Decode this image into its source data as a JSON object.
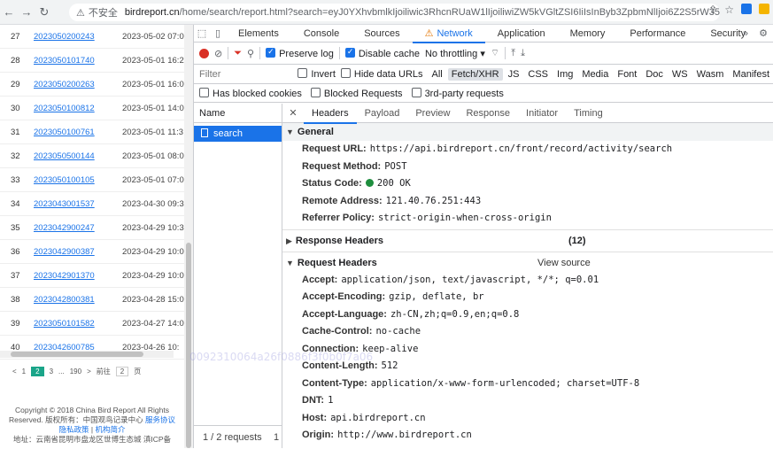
{
  "browser": {
    "security_label": "不安全",
    "url_host": "birdreport.cn",
    "url_path": "/home/search/report.html?search=eyJ0YXhvbmlkIjoiliwic3RhcnRUaW1lIjoiliwiZW5kVGltZSI6IiIsInByb3ZpbmNlIjoi6Z2S5rW355yBIiwiY2l0eSI6IiIsImRpc..."
  },
  "report_list": {
    "rows": [
      {
        "idx": "27",
        "id": "2023050200243",
        "date": "2023-05-02 07:0"
      },
      {
        "idx": "28",
        "id": "2023050101740",
        "date": "2023-05-01 16:2"
      },
      {
        "idx": "29",
        "id": "2023050200263",
        "date": "2023-05-01 16:0"
      },
      {
        "idx": "30",
        "id": "2023050100812",
        "date": "2023-05-01 14:0"
      },
      {
        "idx": "31",
        "id": "2023050100761",
        "date": "2023-05-01 11:3"
      },
      {
        "idx": "32",
        "id": "2023050500144",
        "date": "2023-05-01 08:0"
      },
      {
        "idx": "33",
        "id": "2023050100105",
        "date": "2023-05-01 07:0"
      },
      {
        "idx": "34",
        "id": "2023043001537",
        "date": "2023-04-30 09:3"
      },
      {
        "idx": "35",
        "id": "2023042900247",
        "date": "2023-04-29 10:3"
      },
      {
        "idx": "36",
        "id": "2023042900387",
        "date": "2023-04-29 10:0"
      },
      {
        "idx": "37",
        "id": "2023042901370",
        "date": "2023-04-29 10:0"
      },
      {
        "idx": "38",
        "id": "2023042800381",
        "date": "2023-04-28 15:0"
      },
      {
        "idx": "39",
        "id": "2023050101582",
        "date": "2023-04-27 14:0"
      },
      {
        "idx": "40",
        "id": "2023042600785",
        "date": "2023-04-26 10:"
      }
    ],
    "pager": {
      "prev": "<",
      "p1": "1",
      "p2": "2",
      "p3": "3",
      "ellipsis": "...",
      "last": "190",
      "next": ">",
      "goto": "前往",
      "input": "2",
      "page_unit": "页"
    },
    "footer": {
      "line1": "Copyright © 2018 China Bird Report All Rights",
      "line2": "Reserved. 版权所有：中国观鸟记录中心",
      "line2_link": "服务协议",
      "line3_link1": "隐私政策",
      "line3_link2": "机构简介",
      "line4": "地址：云南省昆明市盘龙区世博生态城",
      "line4_tail": "滇ICP备"
    }
  },
  "devtools": {
    "tabs": [
      "Elements",
      "Console",
      "Sources",
      "Network",
      "Application",
      "Memory",
      "Performance",
      "Security"
    ],
    "active_tab": "Network",
    "toolbar": {
      "preserve_log": "Preserve log",
      "disable_cache": "Disable cache",
      "throttling": "No throttling"
    },
    "filter": {
      "placeholder": "Filter",
      "invert": "Invert",
      "hide_data_urls": "Hide data URLs",
      "types": [
        "All",
        "Fetch/XHR",
        "JS",
        "CSS",
        "Img",
        "Media",
        "Font",
        "Doc",
        "WS",
        "Wasm",
        "Manifest"
      ]
    },
    "blockbar": {
      "blocked_cookies": "Has blocked cookies",
      "blocked_requests": "Blocked Requests",
      "third_party": "3rd-party requests"
    },
    "name_column": {
      "header": "Name",
      "request_name": "search",
      "status": "1 / 2 requests",
      "status_tail": "1"
    },
    "detail_tabs": [
      "Headers",
      "Payload",
      "Preview",
      "Response",
      "Initiator",
      "Timing"
    ],
    "general": {
      "title": "General",
      "request_url_k": "Request URL:",
      "request_url_v": "https://api.birdreport.cn/front/record/activity/search",
      "method_k": "Request Method:",
      "method_v": "POST",
      "status_k": "Status Code:",
      "status_v": "200 OK",
      "remote_k": "Remote Address:",
      "remote_v": "121.40.76.251:443",
      "referrer_k": "Referrer Policy:",
      "referrer_v": "strict-origin-when-cross-origin"
    },
    "response_headers": {
      "title": "Response Headers",
      "count": "(12)"
    },
    "request_headers": {
      "title": "Request Headers",
      "view_source": "View source",
      "items": [
        {
          "k": "Accept:",
          "v": "application/json, text/javascript, */*; q=0.01"
        },
        {
          "k": "Accept-Encoding:",
          "v": "gzip, deflate, br"
        },
        {
          "k": "Accept-Language:",
          "v": "zh-CN,zh;q=0.9,en;q=0.8"
        },
        {
          "k": "Cache-Control:",
          "v": "no-cache"
        },
        {
          "k": "Connection:",
          "v": "keep-alive"
        },
        {
          "k": "Content-Length:",
          "v": "512"
        },
        {
          "k": "Content-Type:",
          "v": "application/x-www-form-urlencoded; charset=UTF-8"
        },
        {
          "k": "DNT:",
          "v": "1"
        },
        {
          "k": "Host:",
          "v": "api.birdreport.cn"
        },
        {
          "k": "Origin:",
          "v": "http://www.birdreport.cn"
        }
      ]
    }
  },
  "watermark": "0092310064a26f0886f3f0b0f7a06"
}
